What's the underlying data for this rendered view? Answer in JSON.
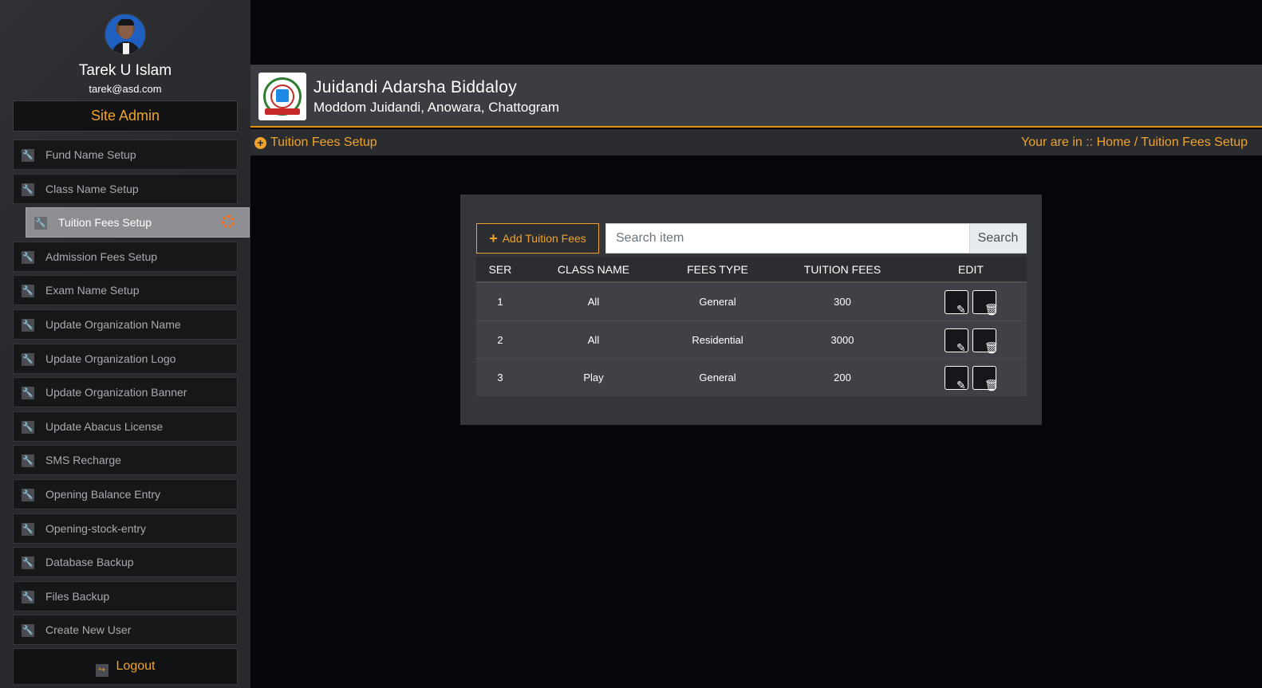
{
  "profile": {
    "name": "Tarek U Islam",
    "email": "tarek@asd.com",
    "role": "Site Admin"
  },
  "menu": [
    {
      "label": "Fund Name Setup"
    },
    {
      "label": "Class Name Setup"
    },
    {
      "label": "Tuition Fees Setup",
      "active": true
    },
    {
      "label": "Admission Fees Setup"
    },
    {
      "label": "Exam Name Setup"
    },
    {
      "label": "Update Organization Name"
    },
    {
      "label": "Update Organization Logo"
    },
    {
      "label": "Update Organization Banner"
    },
    {
      "label": "Update Abacus License"
    },
    {
      "label": "SMS Recharge"
    },
    {
      "label": "Opening Balance Entry"
    },
    {
      "label": "Opening-stock-entry"
    },
    {
      "label": "Database Backup"
    },
    {
      "label": "Files Backup"
    },
    {
      "label": "Create New User"
    }
  ],
  "logout_label": "Logout",
  "header": {
    "org_name": "Juidandi Adarsha Biddaloy",
    "org_address": "Moddom Juidandi, Anowara, Chattogram"
  },
  "breadcrumb": {
    "title": "Tuition Fees Setup",
    "path": "Your are in :: Home / Tuition Fees Setup"
  },
  "toolbar": {
    "add_label": "Add Tuition Fees",
    "search_placeholder": "Search item",
    "search_label": "Search"
  },
  "table": {
    "headers": {
      "ser": "SER",
      "class_name": "CLASS NAME",
      "fees_type": "FEES TYPE",
      "tuition_fees": "TUITION FEES",
      "edit": "EDIT"
    },
    "rows": [
      {
        "ser": "1",
        "class_name": "All",
        "fees_type": "General",
        "tuition_fees": "300"
      },
      {
        "ser": "2",
        "class_name": "All",
        "fees_type": "Residential",
        "tuition_fees": "3000"
      },
      {
        "ser": "3",
        "class_name": "Play",
        "fees_type": "General",
        "tuition_fees": "200"
      }
    ]
  },
  "colors": {
    "accent": "#f0a32a",
    "active_item": "#8e8f92",
    "spinner": "#ff6a13"
  },
  "icons": {
    "menu": "wrench-icon",
    "edit": "pencil-icon",
    "delete": "trash-icon",
    "logout": "logout-icon",
    "add": "plus-icon"
  }
}
